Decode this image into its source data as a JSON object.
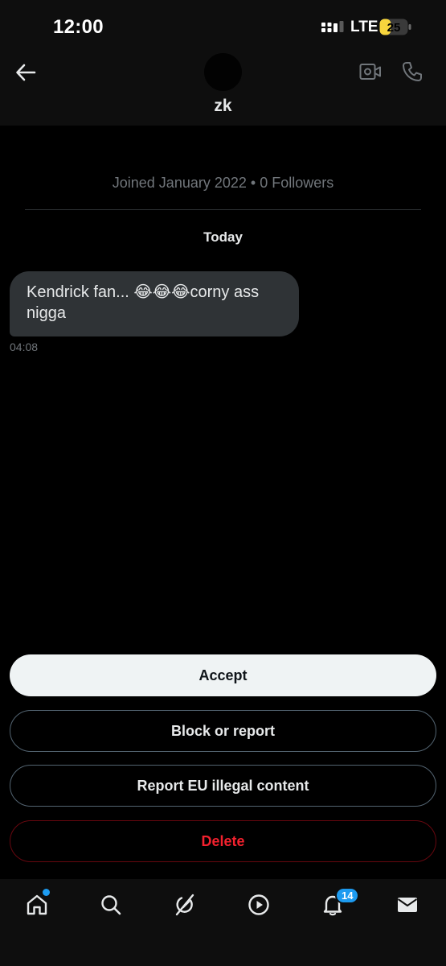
{
  "status_bar": {
    "time": "12:00",
    "network": "LTE",
    "battery": "25",
    "battery_level_percent": 25,
    "icons": [
      "signal-icon",
      "battery-icon"
    ]
  },
  "header": {
    "contact_name": "zk",
    "icons": [
      "back-arrow-icon",
      "video-call-icon",
      "phone-icon"
    ]
  },
  "profile_info": "Joined January 2022 • 0 Followers",
  "date_separator": "Today",
  "message": {
    "text": "Kendrick fan... 😂😂😂corny ass nigga",
    "time": "04:08"
  },
  "actions": {
    "accept": "Accept",
    "block_or_report": "Block or report",
    "report_eu": "Report EU illegal content",
    "delete": "Delete"
  },
  "bottom_nav": {
    "notification_count": "14",
    "icons": [
      "home-icon",
      "search-icon",
      "grok-icon",
      "video-play-icon",
      "bell-icon",
      "mail-icon"
    ]
  },
  "colors": {
    "accent": "#1d9bf0",
    "danger": "#f4212e",
    "bubble": "#2f3336",
    "battery": "#f7d53d"
  }
}
